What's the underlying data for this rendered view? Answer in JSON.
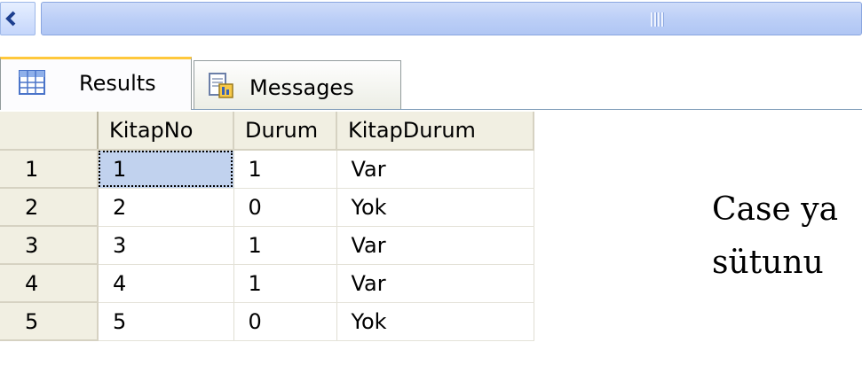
{
  "tabs": [
    {
      "label": "Results",
      "icon": "grid-icon",
      "active": true
    },
    {
      "label": "Messages",
      "icon": "messages-icon",
      "active": false
    }
  ],
  "results": {
    "columns": [
      "KitapNo",
      "Durum",
      "KitapDurum"
    ],
    "rows": [
      {
        "num": "1",
        "KitapNo": "1",
        "Durum": "1",
        "KitapDurum": "Var"
      },
      {
        "num": "2",
        "KitapNo": "2",
        "Durum": "0",
        "KitapDurum": "Yok"
      },
      {
        "num": "3",
        "KitapNo": "3",
        "Durum": "1",
        "KitapDurum": "Var"
      },
      {
        "num": "4",
        "KitapNo": "4",
        "Durum": "1",
        "KitapDurum": "Var"
      },
      {
        "num": "5",
        "KitapNo": "5",
        "Durum": "0",
        "KitapDurum": "Yok"
      }
    ]
  },
  "side_text": {
    "line1": "Case ya",
    "line2": "sütunu"
  },
  "colors": {
    "active_tab_accent": "#ffc83c",
    "selected_cell": "#c1d2ee",
    "header_bg": "#f1efe2"
  }
}
